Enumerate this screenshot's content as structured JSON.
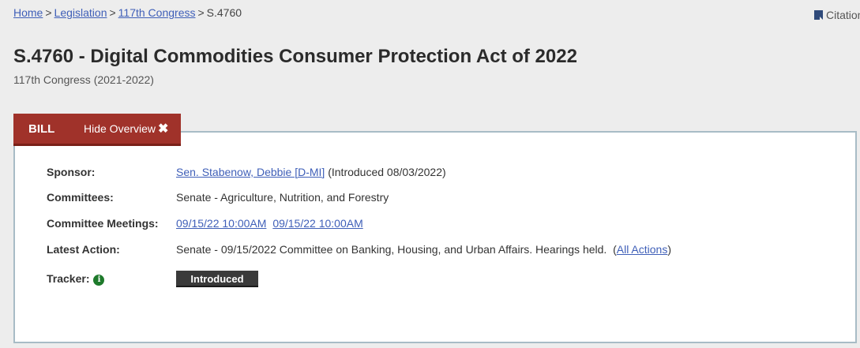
{
  "breadcrumb": {
    "items": [
      {
        "label": "Home",
        "link": true
      },
      {
        "label": "Legislation",
        "link": true
      },
      {
        "label": "117th Congress",
        "link": true
      },
      {
        "label": "S.4760",
        "link": false
      }
    ],
    "separator": ">"
  },
  "citation": {
    "label": "Citation"
  },
  "header": {
    "title": "S.4760 - Digital Commodities Consumer Protection Act of 2022",
    "subtitle": "117th Congress (2021-2022)"
  },
  "tabs": {
    "bill_label": "BILL",
    "hide_overview_label": "Hide Overview",
    "close_glyph": "✖",
    "accent_color": "#a0322a"
  },
  "overview": {
    "sponsor": {
      "label": "Sponsor:",
      "link": "Sen. Stabenow, Debbie [D-MI]",
      "text": "(Introduced 08/03/2022)"
    },
    "committees": {
      "label": "Committees:",
      "value": "Senate - Agriculture, Nutrition, and Forestry"
    },
    "committee_meetings": {
      "label": "Committee Meetings:",
      "meetings": [
        "09/15/22 10:00AM",
        "09/15/22 10:00AM"
      ]
    },
    "latest_action": {
      "label": "Latest Action:",
      "value": "Senate - 09/15/2022 Committee on Banking, Housing, and Urban Affairs. Hearings held.",
      "open_paren": "(",
      "all_actions_link": "All Actions",
      "close_paren": ")"
    },
    "tracker": {
      "label": "Tracker:",
      "info_glyph": "i",
      "status": "Introduced"
    }
  }
}
